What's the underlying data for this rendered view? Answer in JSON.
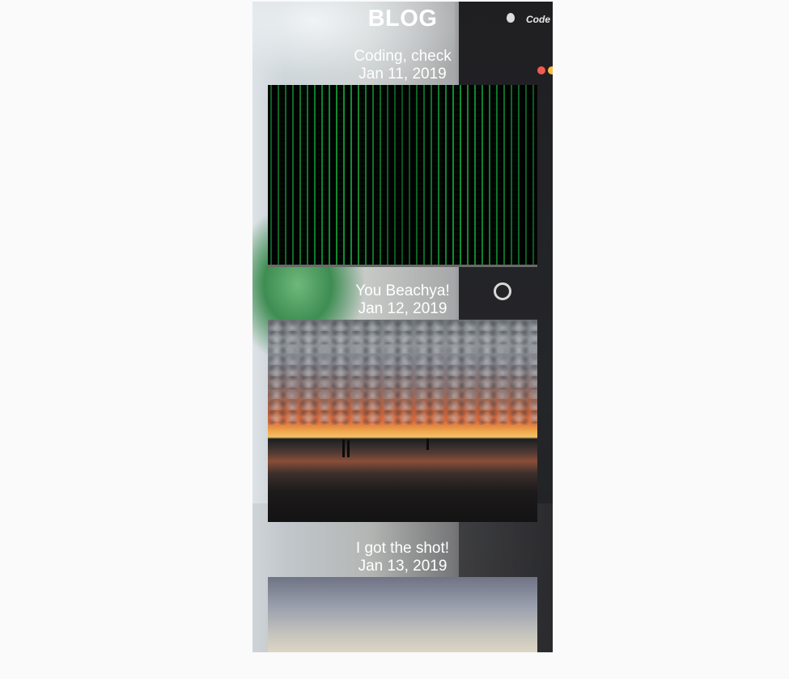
{
  "header": {
    "title": "BLOG"
  },
  "background": {
    "top_right_label": "Code"
  },
  "posts": [
    {
      "title": "Coding, check",
      "date": "Jan 11, 2019",
      "image": "matrix-code-rain"
    },
    {
      "title": "You Beachya!",
      "date": "Jan 12, 2019",
      "image": "beach-sunset"
    },
    {
      "title": "I got the shot!",
      "date": "Jan 13, 2019",
      "image": "evening-sky"
    }
  ],
  "colors": {
    "page_background": "#fafafa",
    "text": "#ffffff",
    "matrix_green": "#19be46"
  }
}
